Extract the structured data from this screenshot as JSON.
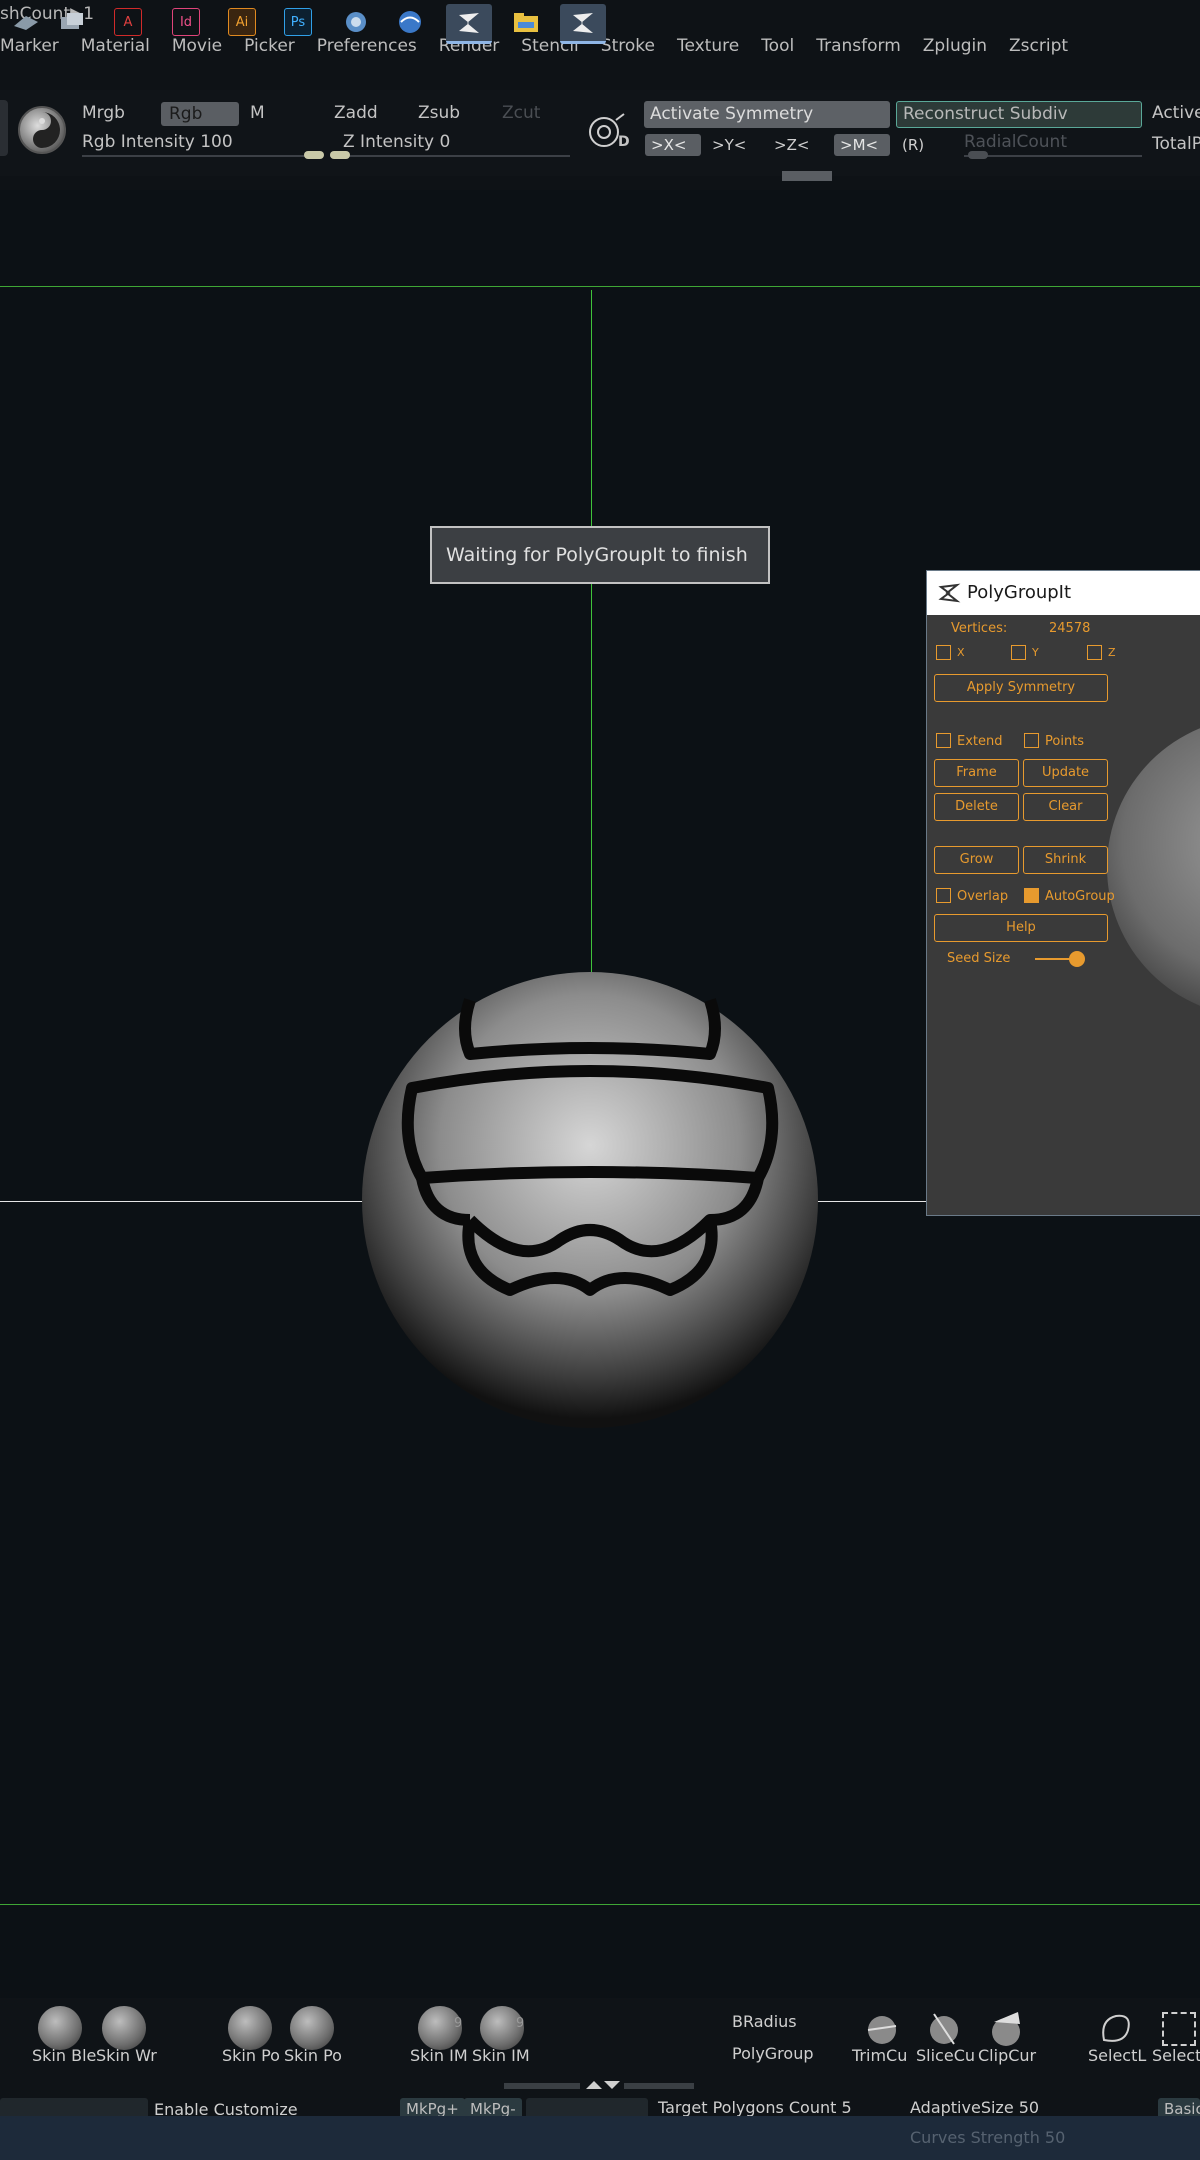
{
  "header": {
    "mesh_count": "shCount▶1"
  },
  "menu": {
    "items": [
      "Marker",
      "Material",
      "Movie",
      "Picker",
      "Preferences",
      "Render",
      "Stencil",
      "Stroke",
      "Texture",
      "Tool",
      "Transform",
      "Zplugin",
      "Zscript"
    ]
  },
  "shelf": {
    "mrgb": "Mrgb",
    "rgb": "Rgb",
    "m": "M",
    "zadd": "Zadd",
    "zsub": "Zsub",
    "zcut": "Zcut",
    "rgb_intensity": "Rgb Intensity 100",
    "z_intensity": "Z Intensity 0",
    "activate_symmetry": "Activate Symmetry",
    "reconstruct_subdiv": "Reconstruct Subdiv",
    "active": "Active",
    "total": "TotalP",
    "axis_x": ">X<",
    "axis_y": ">Y<",
    "axis_z": ">Z<",
    "axis_m": ">M<",
    "radial_r": "(R)",
    "radial_count": "RadialCount",
    "transp_letter": "D"
  },
  "canvas": {
    "waiting_message": "Waiting for PolyGroupIt to finish"
  },
  "panel": {
    "title": "PolyGroupIt",
    "vertices_label": "Vertices:",
    "vertices_value": "24578",
    "check_x": "X",
    "check_y": "Y",
    "check_z": "Z",
    "apply_symmetry": "Apply Symmetry",
    "extend": "Extend",
    "points": "Points",
    "frame": "Frame",
    "update": "Update",
    "delete": "Delete",
    "clear": "Clear",
    "grow": "Grow",
    "shrink": "Shrink",
    "overlap": "Overlap",
    "autogroup": "AutoGroup",
    "help": "Help",
    "seed_size": "Seed Size"
  },
  "bottom_shelf": {
    "brushes": [
      {
        "label": "Skin Ble",
        "num": ""
      },
      {
        "label": "Skin Wr",
        "num": ""
      },
      {
        "label": "Skin Po",
        "num": ""
      },
      {
        "label": "Skin Po",
        "num": ""
      },
      {
        "label": "Skin IM",
        "num": "9"
      },
      {
        "label": "Skin IM",
        "num": "9"
      }
    ],
    "bradius": "BRadius",
    "polygroup": "PolyGroup",
    "tools": [
      "TrimCu",
      "SliceCu",
      "ClipCur",
      "SelectL",
      "Selecti"
    ],
    "enable_customize": "Enable Customize",
    "mkpg_plus": "MkPg+",
    "mkpg_minus": "MkPg-",
    "target_polygons": "Target Polygons Count 5",
    "adaptive_size": "AdaptiveSize 50",
    "basic": "Basic",
    "curves_strength": "Curves Strength 50"
  }
}
